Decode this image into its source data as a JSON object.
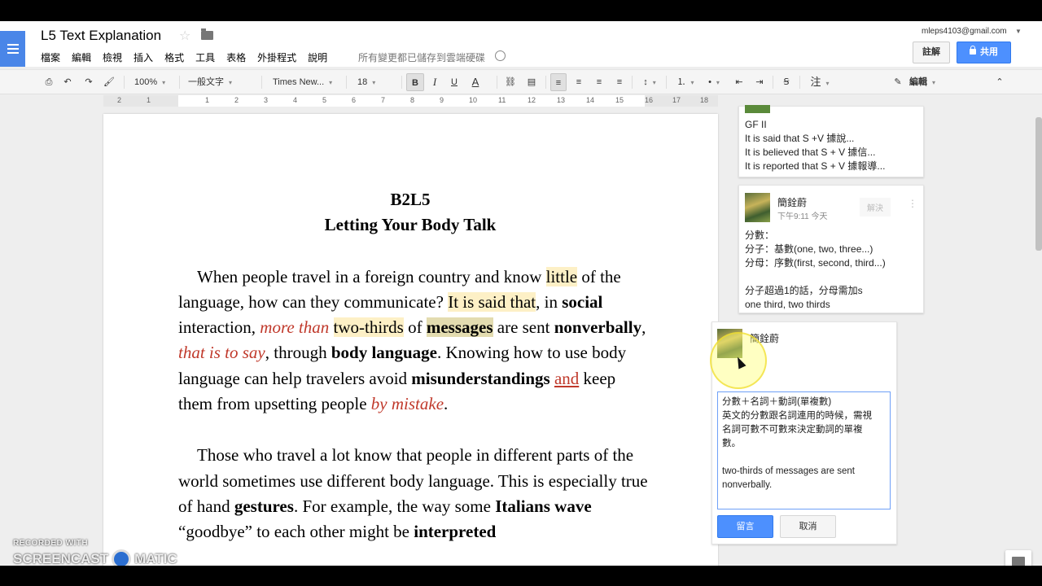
{
  "header": {
    "title": "L5 Text Explanation",
    "menu": [
      "檔案",
      "編輯",
      "檢視",
      "插入",
      "格式",
      "工具",
      "表格",
      "外掛程式",
      "說明"
    ],
    "save_status": "所有變更都已儲存到雲端硬碟",
    "user_email": "mleps4103@gmail.com",
    "comments_label": "註解",
    "share_label": "共用"
  },
  "toolbar": {
    "zoom": "100%",
    "style": "一般文字",
    "font": "Times New...",
    "size": "18",
    "bold": "B",
    "italic": "I",
    "underline": "U",
    "text_color": "A",
    "comment_glyph": "注",
    "mode": "編輯"
  },
  "ruler": {
    "numbers": [
      "2",
      "1",
      "1",
      "2",
      "3",
      "4",
      "5",
      "6",
      "7",
      "8",
      "9",
      "10",
      "11",
      "12",
      "13",
      "14",
      "15",
      "16",
      "17",
      "18"
    ]
  },
  "document": {
    "title_line1": "B2L5",
    "title_line2": "Letting Your Body Talk",
    "p1": {
      "s1": "When people travel in a foreign country and know ",
      "little": "little",
      "s2": " of the language, how can they communicate? ",
      "it_is_said": "It is said that",
      "s3": ", in ",
      "social": "social",
      "s4": " interaction, ",
      "more_than": "more than",
      "s5": " ",
      "two_thirds": "two-thirds",
      "s6": " of ",
      "messages": "messages",
      "s7": " are sent ",
      "nonverbally": "nonverbally",
      "s8": ", ",
      "that_is_to_say": "that is to say",
      "s9": ", through ",
      "body_language": "body language",
      "s10": ". Knowing how to use body language can help travelers avoid ",
      "misunderstandings": "misunderstandings",
      "s11": " ",
      "and": "and",
      "s12": " keep them from upsetting people ",
      "by_mistake": "by mistake",
      "s13": "."
    },
    "p2": {
      "s1": "Those who travel a lot know that people in different parts of the world sometimes use different body language. This is especially true of hand ",
      "gestures": "gestures",
      "s2": ". For example, the way some ",
      "italians_wave": "Italians wave",
      "s3": " “goodbye” to each other might be ",
      "interpreted": "interpreted"
    }
  },
  "comments": {
    "c1": {
      "lines": [
        "GF II",
        "It is said that S +V 據說...",
        "It is believed that S + V 據信...",
        "It is reported that S + V 據報導..."
      ]
    },
    "c2": {
      "author": "簡銓蔚",
      "time": "下午9:11 今天",
      "resolve": "解決",
      "lines": [
        "分數：",
        "分子：基數(one, two, three...)",
        "分母：序數(first, second, third...)",
        "",
        "分子超過1的話，分母需加s",
        "one third, two thirds"
      ]
    },
    "c3": {
      "author": "簡銓蔚",
      "reply_lines": [
        "分數＋名詞＋動詞(單複數)",
        "英文的分數跟名詞連用的時候，需視",
        "名詞可數不可數來決定動詞的單複",
        "數。",
        "",
        "two-thirds of messages are sent",
        "nonverbally."
      ],
      "post_label": "留言",
      "cancel_label": "取消"
    }
  },
  "watermark": {
    "line1": "RECORDED WITH",
    "line2a": "SCREENCAST",
    "line2b": "MATIC"
  }
}
